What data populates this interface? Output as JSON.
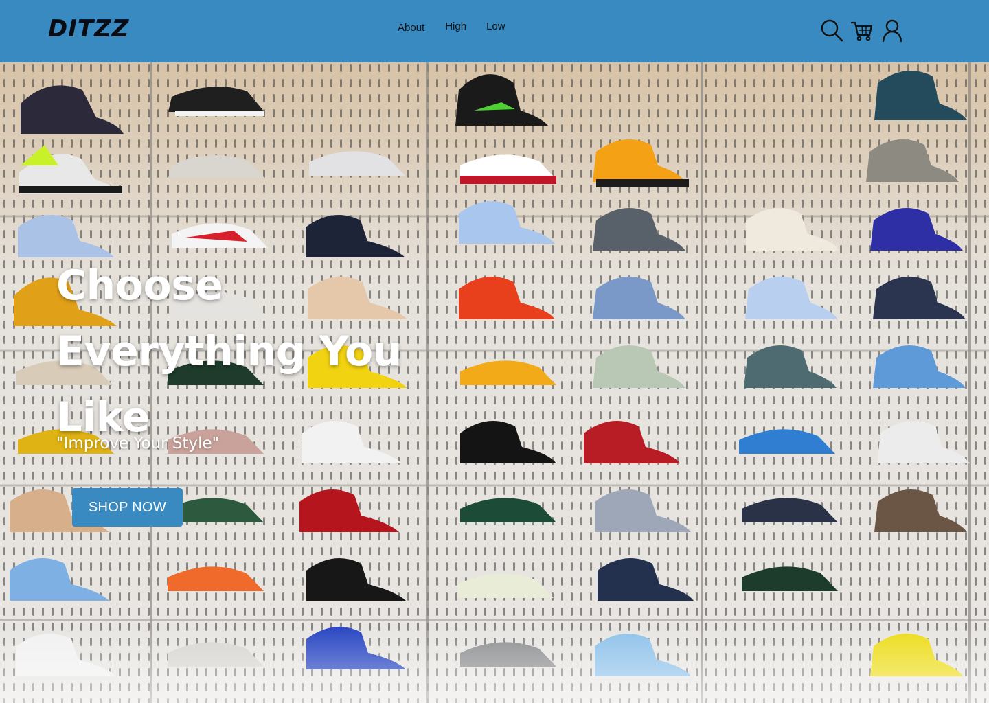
{
  "brand": {
    "logo": "DITZZ"
  },
  "nav": {
    "items": [
      {
        "label": "About"
      },
      {
        "label": "High"
      },
      {
        "label": "Low"
      }
    ]
  },
  "header_icons": [
    "search-icon",
    "cart-icon",
    "user-icon"
  ],
  "hero": {
    "title": "Choose Everything You Like",
    "subtitle": "\"Improve Your Style\"",
    "cta_label": "SHOP NOW"
  },
  "colors": {
    "header_bg": "#388ac0",
    "button_bg": "#388ac0",
    "logo": "#0b0b14",
    "hero_text": "#ffffff"
  }
}
